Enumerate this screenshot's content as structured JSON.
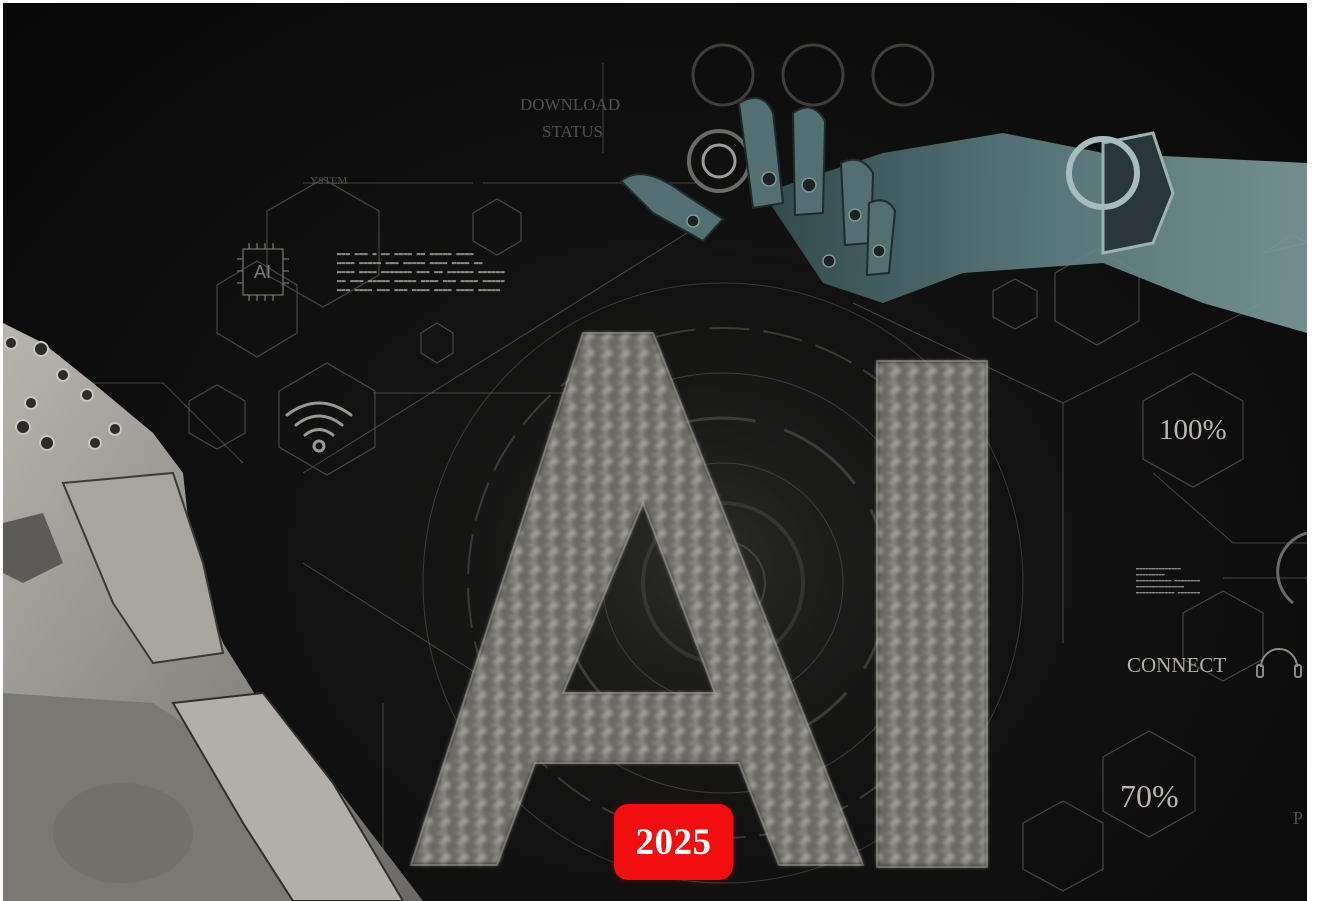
{
  "overlay": {
    "download_line1": "DOWNLOAD",
    "download_line2": "STATUS",
    "system_label": "YSTEM",
    "chip_label": "AI",
    "hero_text": "AI",
    "percent_top": "100%",
    "connect_label": "CONNECT",
    "percent_bottom": "70%",
    "edge_partial": "P"
  },
  "badge": {
    "year": "2025",
    "color": "#f00e0e"
  },
  "colors": {
    "background": "#0c0c0c",
    "robot_arm_left": "#9c9a93",
    "robot_hand_right": "#4d6b6d",
    "ui_lines": "#6f6f6a"
  },
  "icons": [
    "ai-chip-icon",
    "wifi-icon",
    "headset-icon"
  ]
}
